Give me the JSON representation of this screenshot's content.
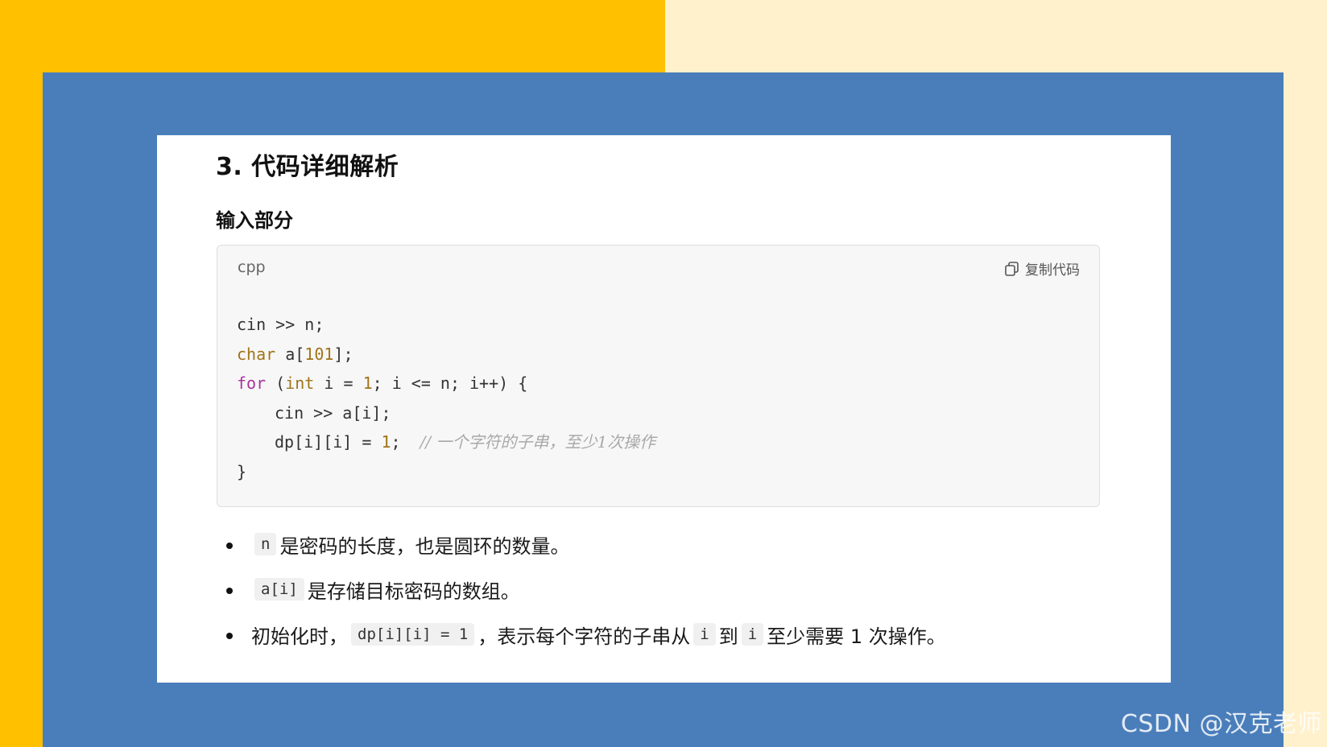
{
  "colors": {
    "left_background": "#ffc000",
    "right_background": "#fff1cc",
    "frame": "#4a7ebb",
    "card": "#ffffff",
    "code_background": "#f7f7f7",
    "keyword_type": "#a0741a",
    "keyword_control": "#a8359d",
    "number": "#a0741a",
    "comment": "#a9a9a9"
  },
  "section": {
    "title": "3. 代码详细解析",
    "subtitle": "输入部分"
  },
  "code_block": {
    "language": "cpp",
    "copy_label": "复制代码",
    "copy_icon": "copy-icon",
    "lines": {
      "l1": "cin >> n;",
      "l2_type": "char",
      "l2_rest_a": " a[",
      "l2_num": "101",
      "l2_rest_b": "];",
      "l3_kw": "for",
      "l3_a": " (",
      "l3_type": "int",
      "l3_b": " i = ",
      "l3_num": "1",
      "l3_c": "; i <= n; i++) {",
      "l4": "cin >> a[i];",
      "l5_a": "dp[i][i] = ",
      "l5_num": "1",
      "l5_b": ";  ",
      "l5_comment": "// 一个字符的子串，至少1次操作",
      "l6": "}"
    }
  },
  "bullets": {
    "b1": {
      "code": "n",
      "text": "是密码的长度，也是圆环的数量。"
    },
    "b2": {
      "code": "a[i]",
      "text": "是存储目标密码的数组。"
    },
    "b3": {
      "text_a": "初始化时，",
      "code_a": "dp[i][i] = 1",
      "text_b": "，表示每个字符的子串从",
      "code_b": "i",
      "text_c": "到",
      "code_c": "i",
      "text_d": "至少需要 1 次操作。"
    }
  },
  "watermark": "CSDN @汉克老师"
}
